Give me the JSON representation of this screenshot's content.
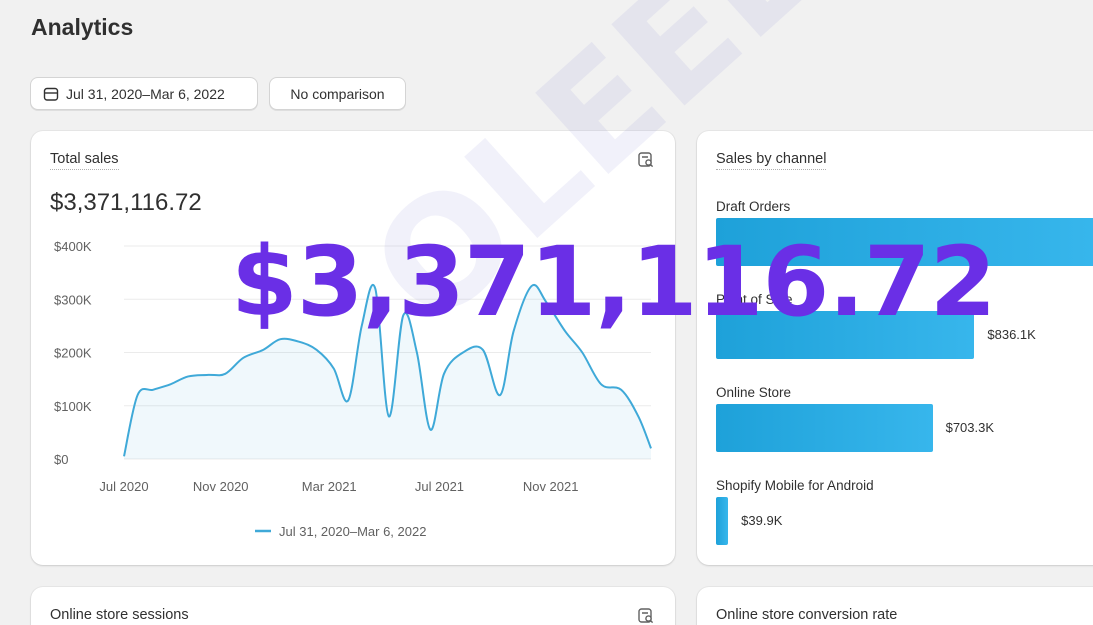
{
  "page": {
    "title": "Analytics"
  },
  "toolbar": {
    "date_range": "Jul 31, 2020–Mar 6, 2022",
    "comparison": "No comparison",
    "calendar_icon": "calendar-icon"
  },
  "total_sales": {
    "title": "Total sales",
    "value": "$3,371,116.72",
    "icon": "chart-search-icon",
    "legend": "Jul 31, 2020–Mar 6, 2022",
    "line_color": "#3fa9d8",
    "chart_data": {
      "type": "line",
      "x_tick_labels": [
        "Jul 2020",
        "Nov 2020",
        "Mar 2021",
        "Jul 2021",
        "Nov 2021"
      ],
      "y_tick_labels": [
        "$400K",
        "$300K",
        "$200K",
        "$100K",
        "$0"
      ],
      "ylim": [
        0,
        400000
      ],
      "grid": true,
      "legend_position": "bottom",
      "series": [
        {
          "name": "Jul 31, 2020–Mar 6, 2022",
          "x": [
            "2020-07-31",
            "2020-08-15",
            "2020-09-01",
            "2020-09-20",
            "2020-10-10",
            "2020-11-01",
            "2020-11-20",
            "2020-12-10",
            "2021-01-01",
            "2021-01-20",
            "2021-02-10",
            "2021-03-01",
            "2021-03-20",
            "2021-04-05",
            "2021-04-20",
            "2021-05-05",
            "2021-05-20",
            "2021-06-05",
            "2021-06-20",
            "2021-07-05",
            "2021-07-20",
            "2021-08-10",
            "2021-09-01",
            "2021-09-20",
            "2021-10-05",
            "2021-10-25",
            "2021-11-10",
            "2021-12-01",
            "2021-12-20",
            "2022-01-10",
            "2022-02-01",
            "2022-02-20",
            "2022-03-06"
          ],
          "values": [
            5000,
            120000,
            130000,
            140000,
            155000,
            158000,
            160000,
            190000,
            205000,
            225000,
            220000,
            205000,
            170000,
            110000,
            250000,
            320000,
            80000,
            270000,
            200000,
            55000,
            160000,
            200000,
            205000,
            120000,
            240000,
            325000,
            295000,
            240000,
            200000,
            140000,
            130000,
            80000,
            20000
          ]
        }
      ]
    }
  },
  "channels": {
    "title": "Sales by channel",
    "bar_color": "#1ea1d9",
    "items": [
      {
        "label": "Draft Orders",
        "value": "",
        "fraction": 1.0
      },
      {
        "label": "Point of Sale",
        "value": "$836.1K",
        "fraction": 0.68
      },
      {
        "label": "Online Store",
        "value": "$703.3K",
        "fraction": 0.57
      },
      {
        "label": "Shopify Mobile for Android",
        "value": "$39.9K",
        "fraction": 0.032
      }
    ]
  },
  "sessions": {
    "title": "Online store sessions",
    "icon": "chart-search-icon"
  },
  "conversion": {
    "title": "Online store conversion rate"
  },
  "overlay_text": "$3,371,116.72",
  "watermark_text": "OLEEE"
}
